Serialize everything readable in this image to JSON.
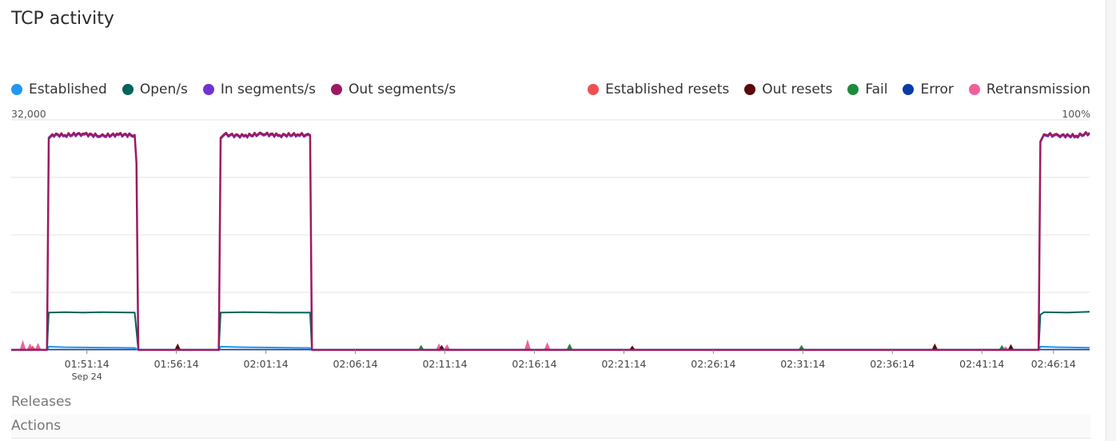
{
  "title": "TCP activity",
  "legend_left": [
    {
      "label": "Established",
      "color": "#2196f3",
      "icon": "circle"
    },
    {
      "label": "Open/s",
      "color": "#00645a",
      "icon": "circle"
    },
    {
      "label": "In segments/s",
      "color": "#7033d1",
      "icon": "circle"
    },
    {
      "label": "Out segments/s",
      "color": "#9c1a5f",
      "icon": "circle"
    }
  ],
  "legend_right": [
    {
      "label": "Established resets",
      "color": "#f05050",
      "icon": "circle"
    },
    {
      "label": "Out resets",
      "color": "#5a0a0a",
      "icon": "circle"
    },
    {
      "label": "Fail",
      "color": "#1e8a3c",
      "icon": "circle"
    },
    {
      "label": "Error",
      "color": "#0a3aa8",
      "icon": "circle"
    },
    {
      "label": "Retransmission",
      "color": "#f0609a",
      "icon": "circle"
    }
  ],
  "axis": {
    "y_left_max_label": "32,000",
    "y_right_max_label": "100%"
  },
  "footer": {
    "releases_label": "Releases",
    "actions_label": "Actions"
  },
  "chart_data": {
    "type": "line",
    "x_unit": "minutes from 01:47:00",
    "x_range": [
      0,
      60.25
    ],
    "ylim_left": [
      0,
      32000
    ],
    "ylim_right": [
      0,
      100
    ],
    "grid": true,
    "xticks": [
      {
        "x": 4.23,
        "label": "01:51:14",
        "sub": "Sep 24"
      },
      {
        "x": 9.23,
        "label": "01:56:14",
        "sub": ""
      },
      {
        "x": 14.23,
        "label": "02:01:14",
        "sub": ""
      },
      {
        "x": 19.23,
        "label": "02:06:14",
        "sub": ""
      },
      {
        "x": 24.23,
        "label": "02:11:14",
        "sub": ""
      },
      {
        "x": 29.23,
        "label": "02:16:14",
        "sub": ""
      },
      {
        "x": 34.23,
        "label": "02:21:14",
        "sub": ""
      },
      {
        "x": 39.23,
        "label": "02:26:14",
        "sub": ""
      },
      {
        "x": 44.23,
        "label": "02:31:14",
        "sub": ""
      },
      {
        "x": 49.23,
        "label": "02:36:14",
        "sub": ""
      },
      {
        "x": 54.23,
        "label": "02:41:14",
        "sub": ""
      },
      {
        "x": 58.23,
        "label": "02:46:14",
        "sub": ""
      }
    ],
    "series": [
      {
        "name": "Out segments/s",
        "color": "#9c1a5f",
        "width": 2.5,
        "points": [
          [
            0,
            0
          ],
          [
            2.0,
            0
          ],
          [
            2.1,
            29500
          ],
          [
            2.3,
            30000
          ],
          [
            3.0,
            29900
          ],
          [
            4.0,
            30100
          ],
          [
            5.0,
            29800
          ],
          [
            6.0,
            30000
          ],
          [
            6.9,
            29900
          ],
          [
            7.0,
            26000
          ],
          [
            7.1,
            0
          ],
          [
            11.6,
            0
          ],
          [
            11.7,
            29500
          ],
          [
            11.9,
            30000
          ],
          [
            13.0,
            29800
          ],
          [
            14.0,
            30100
          ],
          [
            15.0,
            29900
          ],
          [
            16.0,
            30000
          ],
          [
            16.7,
            29900
          ],
          [
            16.8,
            0
          ],
          [
            57.4,
            0
          ],
          [
            57.5,
            29000
          ],
          [
            57.7,
            30000
          ],
          [
            58.5,
            29900
          ],
          [
            59.5,
            29800
          ],
          [
            60.25,
            30200
          ]
        ]
      },
      {
        "name": "In segments/s",
        "color": "#7033d1",
        "width": 1.5,
        "points": [
          [
            0,
            0
          ],
          [
            2.0,
            0
          ],
          [
            2.1,
            29300
          ],
          [
            2.3,
            29800
          ],
          [
            3.0,
            29700
          ],
          [
            4.0,
            29900
          ],
          [
            5.0,
            29600
          ],
          [
            6.0,
            29800
          ],
          [
            6.9,
            29700
          ],
          [
            7.0,
            25800
          ],
          [
            7.1,
            0
          ],
          [
            11.6,
            0
          ],
          [
            11.7,
            29300
          ],
          [
            11.9,
            29800
          ],
          [
            13.0,
            29600
          ],
          [
            14.0,
            29900
          ],
          [
            15.0,
            29700
          ],
          [
            16.0,
            29800
          ],
          [
            16.7,
            29700
          ],
          [
            16.8,
            0
          ],
          [
            57.4,
            0
          ],
          [
            57.5,
            28800
          ],
          [
            57.7,
            29800
          ],
          [
            58.5,
            29700
          ],
          [
            59.5,
            29600
          ],
          [
            60.25,
            30000
          ]
        ]
      },
      {
        "name": "Open/s",
        "color": "#00645a",
        "width": 2,
        "points": [
          [
            0,
            0
          ],
          [
            2.0,
            0
          ],
          [
            2.1,
            5200
          ],
          [
            3.0,
            5250
          ],
          [
            4.0,
            5200
          ],
          [
            5.0,
            5250
          ],
          [
            6.9,
            5200
          ],
          [
            7.1,
            0
          ],
          [
            11.6,
            0
          ],
          [
            11.7,
            5200
          ],
          [
            13.0,
            5250
          ],
          [
            15.0,
            5200
          ],
          [
            16.7,
            5200
          ],
          [
            16.8,
            0
          ],
          [
            57.4,
            0
          ],
          [
            57.5,
            4900
          ],
          [
            57.7,
            5250
          ],
          [
            59.0,
            5200
          ],
          [
            60.25,
            5300
          ]
        ]
      },
      {
        "name": "Established",
        "color": "#2196f3",
        "width": 2,
        "points": [
          [
            0,
            0
          ],
          [
            2.0,
            0
          ],
          [
            2.1,
            450
          ],
          [
            3.0,
            380
          ],
          [
            4.5,
            330
          ],
          [
            6.0,
            300
          ],
          [
            6.9,
            280
          ],
          [
            7.1,
            0
          ],
          [
            11.6,
            0
          ],
          [
            11.7,
            450
          ],
          [
            13.0,
            380
          ],
          [
            14.5,
            330
          ],
          [
            16.7,
            280
          ],
          [
            16.8,
            0
          ],
          [
            57.4,
            0
          ],
          [
            57.5,
            450
          ],
          [
            58.5,
            380
          ],
          [
            60.25,
            300
          ]
        ]
      },
      {
        "name": "Error",
        "color": "#0a3aa8",
        "width": 1.5,
        "points": [
          [
            0,
            60
          ],
          [
            60.25,
            60
          ]
        ]
      }
    ],
    "spikes": [
      {
        "series": "Retransmission",
        "color": "#f0609a",
        "x": 0.65,
        "value": 1400
      },
      {
        "series": "Retransmission",
        "color": "#f0609a",
        "x": 1.05,
        "value": 900
      },
      {
        "series": "Retransmission",
        "color": "#f0609a",
        "x": 1.5,
        "value": 1000
      },
      {
        "series": "Established resets",
        "color": "#f05050",
        "x": 1.2,
        "value": 600
      },
      {
        "series": "Out resets",
        "color": "#5a0a0a",
        "x": 9.3,
        "value": 900
      },
      {
        "series": "Fail",
        "color": "#1e8a3c",
        "x": 22.9,
        "value": 700
      },
      {
        "series": "Retransmission",
        "color": "#f0609a",
        "x": 23.9,
        "value": 900
      },
      {
        "series": "Out resets",
        "color": "#5a0a0a",
        "x": 24.05,
        "value": 700
      },
      {
        "series": "Retransmission",
        "color": "#f0609a",
        "x": 24.35,
        "value": 800
      },
      {
        "series": "Retransmission",
        "color": "#f0609a",
        "x": 28.85,
        "value": 1500
      },
      {
        "series": "Retransmission",
        "color": "#f0609a",
        "x": 29.95,
        "value": 1100
      },
      {
        "series": "Fail",
        "color": "#1e8a3c",
        "x": 31.2,
        "value": 900
      },
      {
        "series": "Out resets",
        "color": "#5a0a0a",
        "x": 34.7,
        "value": 600
      },
      {
        "series": "Fail",
        "color": "#1e8a3c",
        "x": 44.15,
        "value": 700
      },
      {
        "series": "Out resets",
        "color": "#5a0a0a",
        "x": 51.6,
        "value": 900
      },
      {
        "series": "Fail",
        "color": "#1e8a3c",
        "x": 55.35,
        "value": 700
      },
      {
        "series": "Out resets",
        "color": "#5a0a0a",
        "x": 55.85,
        "value": 800
      },
      {
        "series": "Retransmission",
        "color": "#f0609a",
        "x": 55.55,
        "value": 500
      }
    ]
  }
}
